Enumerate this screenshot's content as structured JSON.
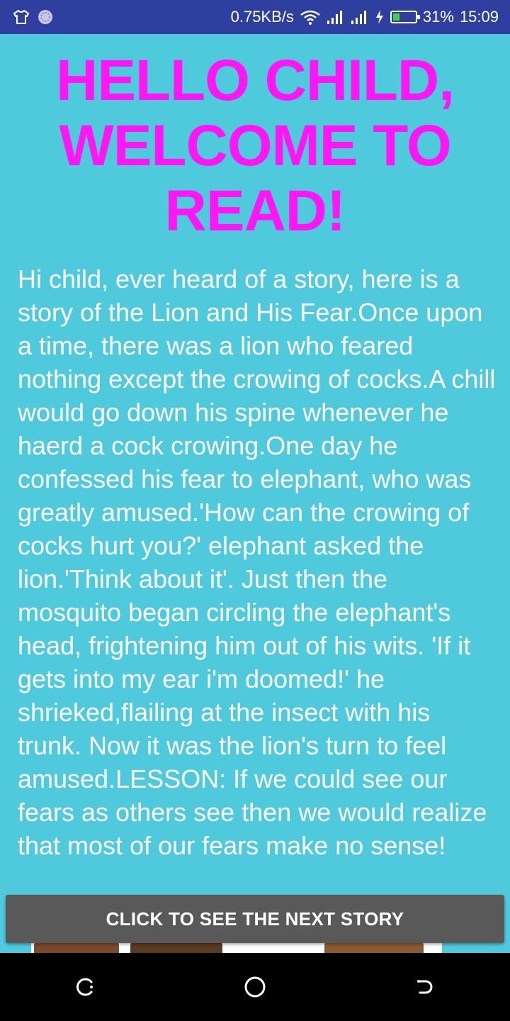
{
  "status_bar": {
    "network_speed": "0.75KB/s",
    "battery_percent": "31%",
    "battery_level": 0.31,
    "time": "15:09",
    "icons": [
      "shirt-icon",
      "sync-icon",
      "wifi-icon",
      "signal-icon",
      "signal-icon",
      "charging-icon",
      "battery-icon"
    ],
    "battery_fill_color": "#45d045"
  },
  "title": "HELLO CHILD, WELCOME TO READ!",
  "story": "Hi child, ever heard of a story, here is a story of the Lion and His Fear.Once upon a time, there was a lion who feared nothing except the crowing of cocks.A chill would go down his spine whenever he haerd a cock crowing.One day he confessed his fear to elephant, who was greatly amused.'How can the crowing of cocks hurt you?' elephant asked the lion.'Think about it'. Just then the mosquito began circling the elephant's head, frightening him out of his wits. 'If it gets into my ear i'm doomed!' he shrieked,flailing at the insect with his trunk. Now it was the lion's turn to feel amused.LESSON: If we could see our fears as others see then we would realize that most of our fears make no sense!",
  "next_button": {
    "label": "CLICK TO SEE THE NEXT STORY"
  },
  "nav_bar": {
    "icons": [
      "recents-icon",
      "home-icon",
      "back-icon"
    ]
  },
  "colors": {
    "background": "#4ecadc",
    "title": "#ff16f2",
    "status_bar": "#2f3fa0",
    "button": "#595959"
  }
}
